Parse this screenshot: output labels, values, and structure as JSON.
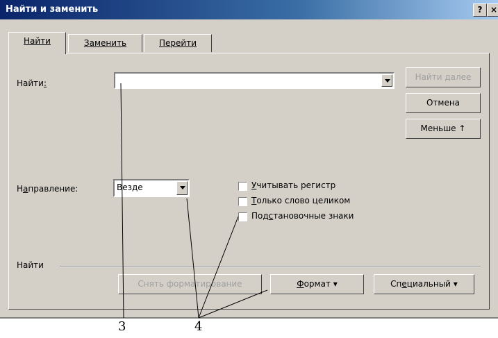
{
  "window": {
    "title": "Найти и заменить",
    "help_glyph": "?",
    "close_glyph": "×"
  },
  "tabs": [
    {
      "label": "Найти",
      "mnemonic_index": 0
    },
    {
      "label": "Заменить",
      "mnemonic_index": 0
    },
    {
      "label": "Перейти",
      "mnemonic_index": 0
    }
  ],
  "find": {
    "label_prefix": "Найти",
    "label_mnemonic": ":",
    "value": ""
  },
  "buttons": {
    "find_next": "Найти далее",
    "cancel": "Отмена",
    "less": "Меньше ↑"
  },
  "direction": {
    "label_pre": "Н",
    "label_mn": "а",
    "label_post": "правление:",
    "value": "Везде"
  },
  "options": [
    {
      "pre": "",
      "mn": "У",
      "post": "читывать регистр",
      "checked": false
    },
    {
      "pre": "",
      "mn": "Т",
      "post": "олько слово целиком",
      "checked": false
    },
    {
      "pre": "Под",
      "mn": "с",
      "post": "тановочные знаки",
      "checked": false
    }
  ],
  "group_label": "Найти",
  "bottom_buttons": {
    "clear_format": "Снять форматирование",
    "format_pre": "",
    "format_mn": "Ф",
    "format_post": "ормат ▾",
    "special_pre": "Сп",
    "special_mn": "е",
    "special_post": "циальный ▾"
  },
  "callout_numbers": {
    "n3": "3",
    "n4": "4"
  }
}
